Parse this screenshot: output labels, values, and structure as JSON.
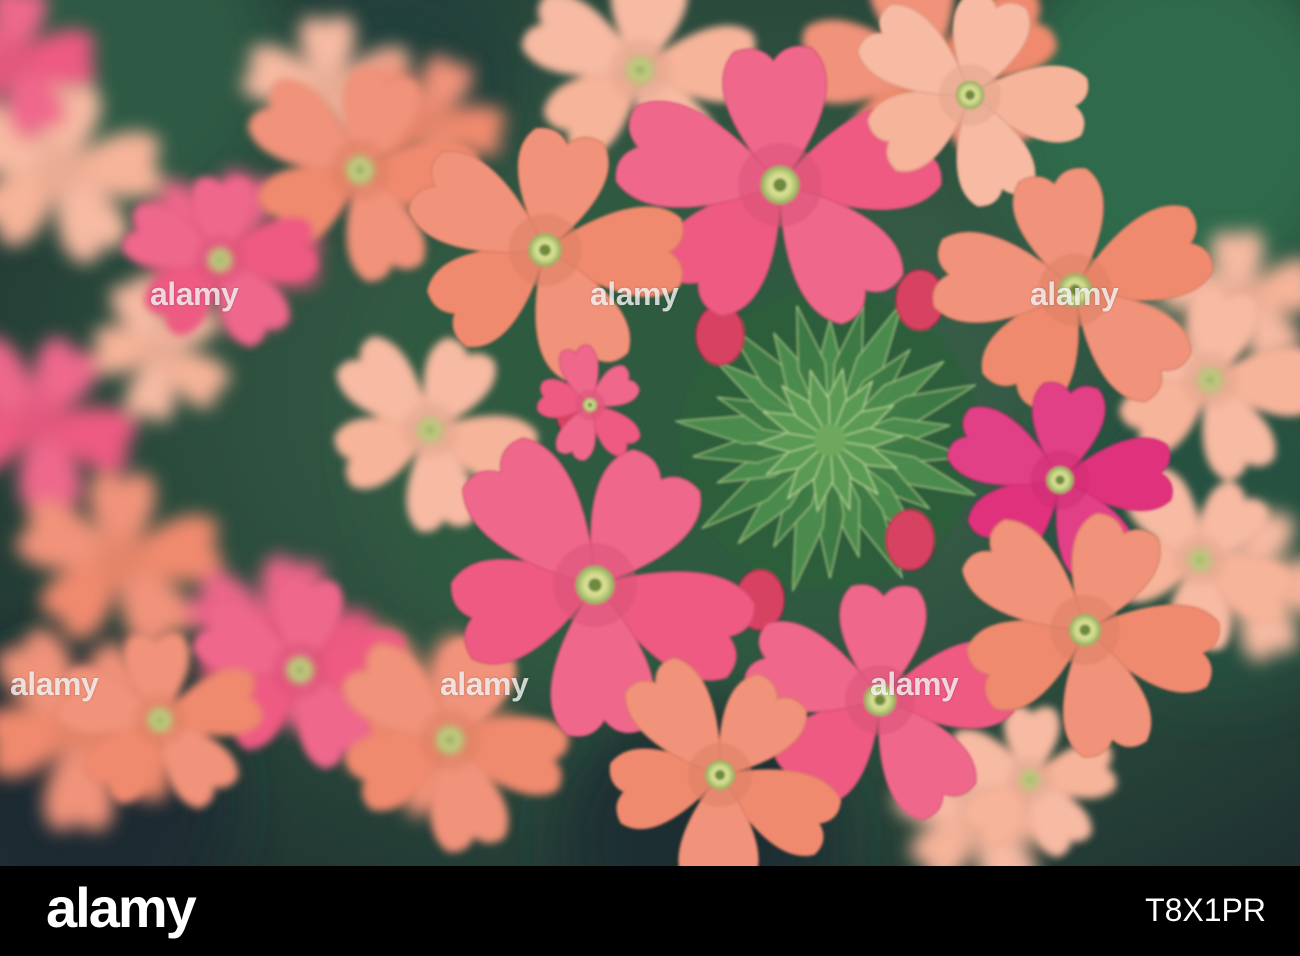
{
  "photo": {
    "subject": "verbena flower cluster",
    "colors": {
      "background_green": "#2a4a3a",
      "leaf_green": "#3f7a45",
      "coral": "#f08a6e",
      "pink": "#ee5a82",
      "magenta": "#e0307c",
      "peach": "#f6b49a",
      "flower_center": "#eef0b4"
    }
  },
  "watermark": {
    "text": "alamy"
  },
  "footer": {
    "logo": "alamy",
    "image_id": "T8X1PR"
  }
}
